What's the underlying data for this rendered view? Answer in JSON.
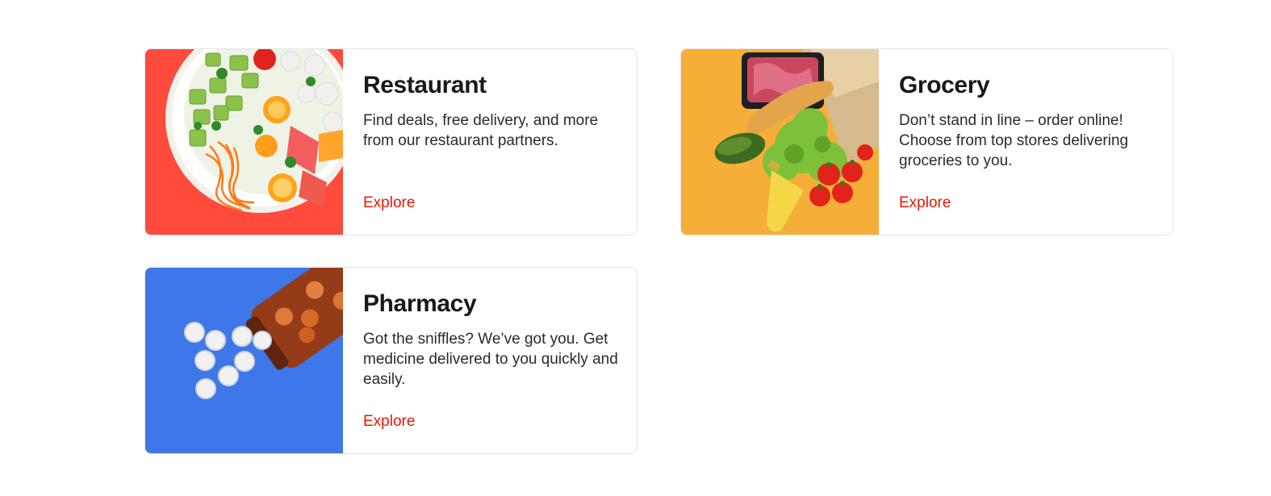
{
  "colors": {
    "link": "#eb1700",
    "restaurant_bg": "#ff4a3c",
    "grocery_bg": "#f5ae37",
    "pharmacy_bg": "#3d77ea"
  },
  "cards": [
    {
      "image_name": "restaurant-food-bowl-image",
      "title": "Restaurant",
      "description": "Find deals, free delivery, and more from our restaurant partners.",
      "link": "Explore"
    },
    {
      "image_name": "grocery-bag-image",
      "title": "Grocery",
      "description": "Don’t stand in line – order online! Choose from top stores delivering groceries to you.",
      "link": "Explore"
    },
    {
      "image_name": "pharmacy-pills-image",
      "title": "Pharmacy",
      "description": "Got the sniffles? We’ve got you. Get medicine delivered to you quickly and easily.",
      "link": "Explore"
    }
  ]
}
